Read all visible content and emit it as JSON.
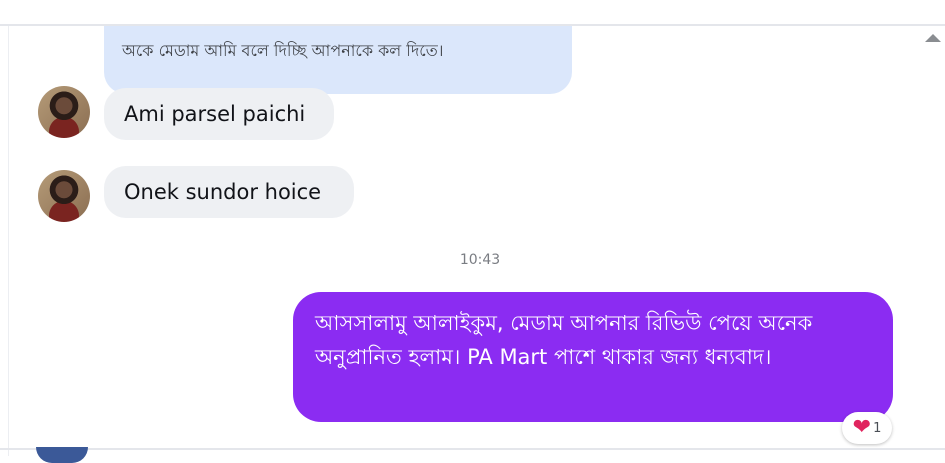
{
  "conversation": {
    "messages": [
      {
        "sender": "contact",
        "text": "অকে মেডাম আমি বলে দিচ্ছি আপনাকে কল দিতে।"
      },
      {
        "sender": "contact",
        "text": "Ami parsel paichi"
      },
      {
        "sender": "contact",
        "text": "Onek sundor hoice"
      },
      {
        "sender": "me",
        "text": "আসসালামু আলাইকুম, মেডাম আপনার রিভিউ পেয়ে অনেক অনুপ্রানিত হলাম। PA Mart পাশে থাকার জন্য ধন্যবাদ।"
      }
    ],
    "timestamp": "10:43",
    "reaction": {
      "emoji": "heart",
      "count": "1"
    }
  },
  "colors": {
    "sent_bubble": "#8b2cf2",
    "received_bubble": "#eef0f3",
    "highlight_bubble": "#dbe7fb",
    "reaction_heart": "#e0245e"
  },
  "icons": {
    "scroll_up": "triangle-up-icon",
    "reaction": "heart-icon"
  }
}
